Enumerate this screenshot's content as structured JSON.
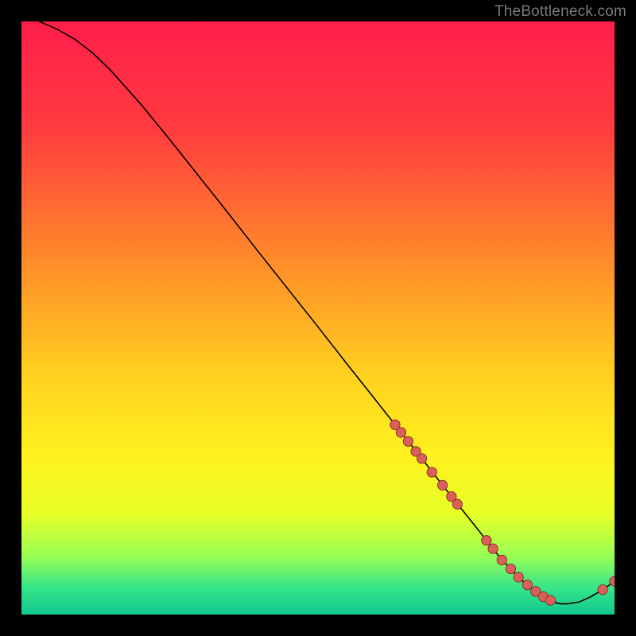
{
  "watermark": "TheBottleneck.com",
  "chart_data": {
    "type": "line",
    "title": "",
    "xlabel": "",
    "ylabel": "",
    "xlim": [
      0,
      100
    ],
    "ylim": [
      0,
      100
    ],
    "grid": false,
    "legend": false,
    "series": [
      {
        "name": "curve",
        "x": [
          3,
          6,
          9,
          12,
          15,
          20,
          25,
          30,
          35,
          40,
          45,
          50,
          55,
          60,
          63,
          66,
          69,
          71,
          73,
          75,
          77,
          78.4,
          79.5,
          81,
          82.5,
          83.8,
          85.3,
          86.7,
          88,
          89.2,
          90,
          91,
          92,
          94,
          96,
          98,
          100
        ],
        "y": [
          100,
          98.7,
          97,
          94.7,
          91.8,
          86.2,
          80.1,
          73.8,
          67.5,
          61.1,
          54.8,
          48.5,
          42.1,
          35.8,
          32,
          28.2,
          24.4,
          21.8,
          19.3,
          16.8,
          14.3,
          12.5,
          11.1,
          9.2,
          7.7,
          6.3,
          5.0,
          3.9,
          3.0,
          2.4,
          2.0,
          1.8,
          1.8,
          2.1,
          3.0,
          4.2,
          5.6
        ]
      }
    ],
    "points": {
      "name": "markers",
      "x": [
        63.0,
        64.0,
        65.2,
        66.5,
        67.5,
        69.2,
        71.0,
        72.5,
        73.5,
        78.4,
        79.5,
        81.0,
        82.5,
        83.8,
        85.3,
        86.7,
        88.0,
        89.2,
        98.0,
        100.0
      ],
      "y": [
        32.0,
        30.7,
        29.2,
        27.5,
        26.3,
        24.0,
        21.8,
        19.9,
        18.6,
        12.5,
        11.1,
        9.2,
        7.7,
        6.3,
        5.0,
        3.9,
        3.0,
        2.4,
        4.2,
        5.6
      ]
    },
    "background_gradient": {
      "stops": [
        {
          "offset": 0.0,
          "color": "#ff1e4b"
        },
        {
          "offset": 0.18,
          "color": "#ff3b3f"
        },
        {
          "offset": 0.4,
          "color": "#ff8a2a"
        },
        {
          "offset": 0.6,
          "color": "#ffd21f"
        },
        {
          "offset": 0.73,
          "color": "#fff11f"
        },
        {
          "offset": 0.83,
          "color": "#e8ff26"
        },
        {
          "offset": 0.9,
          "color": "#9aff54"
        },
        {
          "offset": 0.955,
          "color": "#36e48a"
        },
        {
          "offset": 1.0,
          "color": "#12c98f"
        }
      ]
    },
    "colors": {
      "line": "#000000",
      "marker_fill": "#d9605a",
      "marker_stroke": "#7a231e"
    }
  }
}
